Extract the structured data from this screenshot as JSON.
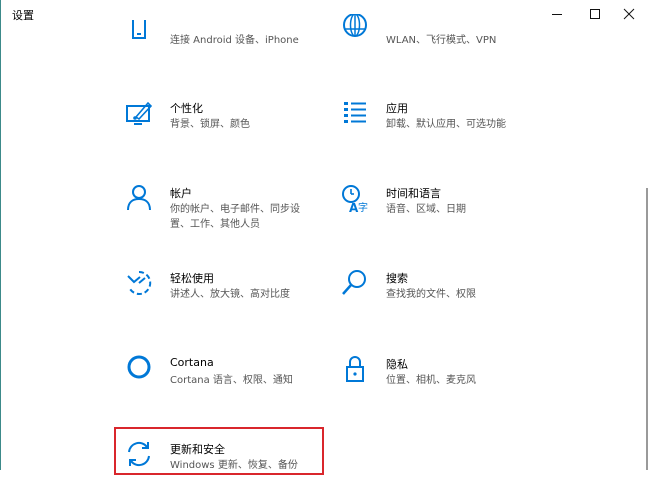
{
  "window": {
    "title": "设置",
    "controls": {
      "minimize": "—",
      "maximize": "☐",
      "close": "✕"
    }
  },
  "colors": {
    "accent": "#0078d7",
    "highlight_border": "#d9262c"
  },
  "tiles": [
    {
      "id": "phone",
      "title": "",
      "desc": "连接 Android 设备、iPhone",
      "icon": "phone-icon"
    },
    {
      "id": "network",
      "title": "",
      "desc": "WLAN、飞行模式、VPN",
      "icon": "globe-icon"
    },
    {
      "id": "personalization",
      "title": "个性化",
      "desc": "背景、锁屏、颜色",
      "icon": "paint-monitor-icon"
    },
    {
      "id": "apps",
      "title": "应用",
      "desc": "卸载、默认应用、可选功能",
      "icon": "apps-list-icon"
    },
    {
      "id": "accounts",
      "title": "帐户",
      "desc": "你的帐户、电子邮件、同步设置、工作、其他人员",
      "icon": "person-icon"
    },
    {
      "id": "time-language",
      "title": "时间和语言",
      "desc": "语音、区域、日期",
      "icon": "time-language-icon"
    },
    {
      "id": "ease-of-access",
      "title": "轻松使用",
      "desc": "讲述人、放大镜、高对比度",
      "icon": "ease-of-access-icon"
    },
    {
      "id": "search",
      "title": "搜索",
      "desc": "查找我的文件、权限",
      "icon": "search-icon"
    },
    {
      "id": "cortana",
      "title": "Cortana",
      "desc": "Cortana 语言、权限、通知",
      "icon": "cortana-icon"
    },
    {
      "id": "privacy",
      "title": "隐私",
      "desc": "位置、相机、麦克风",
      "icon": "lock-icon"
    },
    {
      "id": "update-security",
      "title": "更新和安全",
      "desc": "Windows 更新、恢复、备份",
      "icon": "sync-icon"
    }
  ]
}
